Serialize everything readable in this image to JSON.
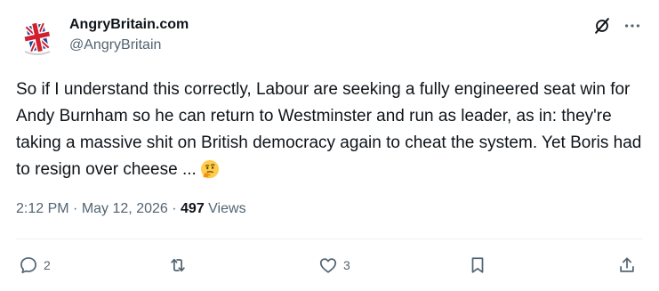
{
  "author": {
    "display_name": "AngryBritain.com",
    "handle": "@AngryBritain"
  },
  "tweet": {
    "text": "So if I understand this correctly, Labour are seeking a fully engineered seat win for Andy Burnham so he can return to Westminster and run as leader, as in: they're taking a massive shit on British democracy again to cheat the system. Yet Boris had to resign over cheese ...",
    "emoji": "thinking-face"
  },
  "meta": {
    "time": "2:12 PM",
    "separator": "·",
    "date": "May 12, 2026",
    "views_count": "497",
    "views_label": "Views"
  },
  "actions": {
    "reply_count": "2",
    "retweet_count": "",
    "like_count": "3"
  },
  "icons": {
    "header": [
      "grok-icon",
      "more-icon"
    ],
    "actions": [
      "reply-icon",
      "retweet-icon",
      "like-icon",
      "bookmark-icon",
      "share-icon"
    ]
  },
  "colors": {
    "text_primary": "#0f1419",
    "text_secondary": "#536471",
    "divider": "#eff3f4"
  }
}
